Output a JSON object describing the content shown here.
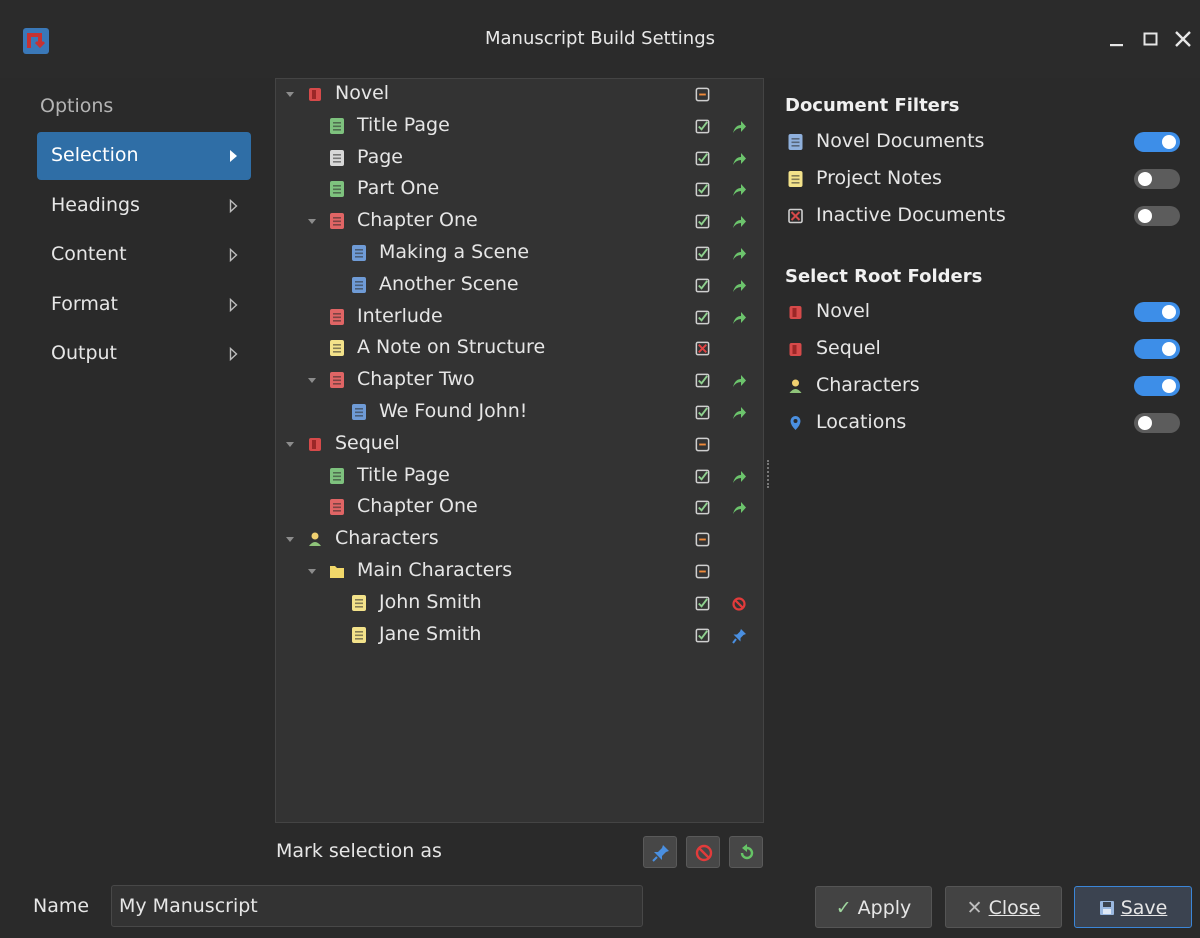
{
  "window": {
    "title": "Manuscript Build Settings"
  },
  "options": {
    "header": "Options",
    "items": [
      {
        "label": "Selection",
        "active": true
      },
      {
        "label": "Headings",
        "active": false
      },
      {
        "label": "Content",
        "active": false
      },
      {
        "label": "Format",
        "active": false
      },
      {
        "label": "Output",
        "active": false
      }
    ]
  },
  "tree": {
    "rows": [
      {
        "label": "Novel",
        "depth": 0,
        "expandable": true,
        "icon": "novel-root-icon",
        "status": "minus-box-icon",
        "action": null
      },
      {
        "label": "Title Page",
        "depth": 1,
        "expandable": false,
        "icon": "title-page-doc-icon",
        "status": "checked-box-icon",
        "action": "included-arrow-icon"
      },
      {
        "label": "Page",
        "depth": 1,
        "expandable": false,
        "icon": "page-doc-icon",
        "status": "checked-box-icon",
        "action": "included-arrow-icon"
      },
      {
        "label": "Part One",
        "depth": 1,
        "expandable": false,
        "icon": "part-doc-icon",
        "status": "checked-box-icon",
        "action": "included-arrow-icon"
      },
      {
        "label": "Chapter One",
        "depth": 1,
        "expandable": true,
        "icon": "chapter-doc-icon",
        "status": "checked-box-icon",
        "action": "included-arrow-icon"
      },
      {
        "label": "Making a Scene",
        "depth": 2,
        "expandable": false,
        "icon": "scene-doc-icon",
        "status": "checked-box-icon",
        "action": "included-arrow-icon"
      },
      {
        "label": "Another Scene",
        "depth": 2,
        "expandable": false,
        "icon": "scene-doc-icon",
        "status": "checked-box-icon",
        "action": "included-arrow-icon"
      },
      {
        "label": "Interlude",
        "depth": 1,
        "expandable": false,
        "icon": "chapter-doc-icon",
        "status": "checked-box-icon",
        "action": "included-arrow-icon"
      },
      {
        "label": "A Note on Structure",
        "depth": 1,
        "expandable": false,
        "icon": "note-doc-icon",
        "status": "inactive-box-icon",
        "action": null
      },
      {
        "label": "Chapter Two",
        "depth": 1,
        "expandable": true,
        "icon": "chapter-doc-icon",
        "status": "checked-box-icon",
        "action": "included-arrow-icon"
      },
      {
        "label": "We Found John!",
        "depth": 2,
        "expandable": false,
        "icon": "scene-doc-icon",
        "status": "checked-box-icon",
        "action": "included-arrow-icon"
      },
      {
        "label": "Sequel",
        "depth": 0,
        "expandable": true,
        "icon": "novel-root-icon",
        "status": "minus-box-icon",
        "action": null
      },
      {
        "label": "Title Page",
        "depth": 1,
        "expandable": false,
        "icon": "title-page-doc-icon",
        "status": "checked-box-icon",
        "action": "included-arrow-icon"
      },
      {
        "label": "Chapter One",
        "depth": 1,
        "expandable": false,
        "icon": "chapter-doc-icon",
        "status": "checked-box-icon",
        "action": "included-arrow-icon"
      },
      {
        "label": "Characters",
        "depth": 0,
        "expandable": true,
        "icon": "characters-root-icon",
        "status": "minus-box-icon",
        "action": null
      },
      {
        "label": "Main Characters",
        "depth": 1,
        "expandable": true,
        "icon": "folder-icon",
        "status": "minus-box-icon",
        "action": null
      },
      {
        "label": "John Smith",
        "depth": 2,
        "expandable": false,
        "icon": "note-doc-icon",
        "status": "checked-box-icon",
        "action": "excluded-icon"
      },
      {
        "label": "Jane Smith",
        "depth": 2,
        "expandable": false,
        "icon": "note-doc-icon",
        "status": "checked-box-icon",
        "action": "pinned-icon"
      }
    ]
  },
  "mark_selection": {
    "label": "Mark selection as",
    "buttons": [
      "pin-icon",
      "exclude-icon",
      "reset-icon"
    ]
  },
  "document_filters": {
    "title": "Document Filters",
    "items": [
      {
        "label": "Novel Documents",
        "icon": "novel-doc-filter-icon",
        "enabled": true
      },
      {
        "label": "Project Notes",
        "icon": "project-notes-icon",
        "enabled": false
      },
      {
        "label": "Inactive Documents",
        "icon": "inactive-doc-icon",
        "enabled": false
      }
    ]
  },
  "root_folders": {
    "title": "Select Root Folders",
    "items": [
      {
        "label": "Novel",
        "icon": "novel-root-icon",
        "enabled": true
      },
      {
        "label": "Sequel",
        "icon": "novel-root-icon",
        "enabled": true
      },
      {
        "label": "Characters",
        "icon": "characters-root-icon",
        "enabled": true
      },
      {
        "label": "Locations",
        "icon": "location-pin-icon",
        "enabled": false
      }
    ]
  },
  "footer": {
    "name_label": "Name",
    "name_value": "My Manuscript",
    "apply_label": "Apply",
    "close_label": "Close",
    "save_label": "Save"
  },
  "colors": {
    "accent": "#2f6ea6",
    "switch_on": "#3d8ee8",
    "novel_red": "#d64a4a",
    "doc_green": "#7ec27e",
    "doc_blue": "#6f9bd6",
    "note_yellow": "#f3e28a"
  }
}
